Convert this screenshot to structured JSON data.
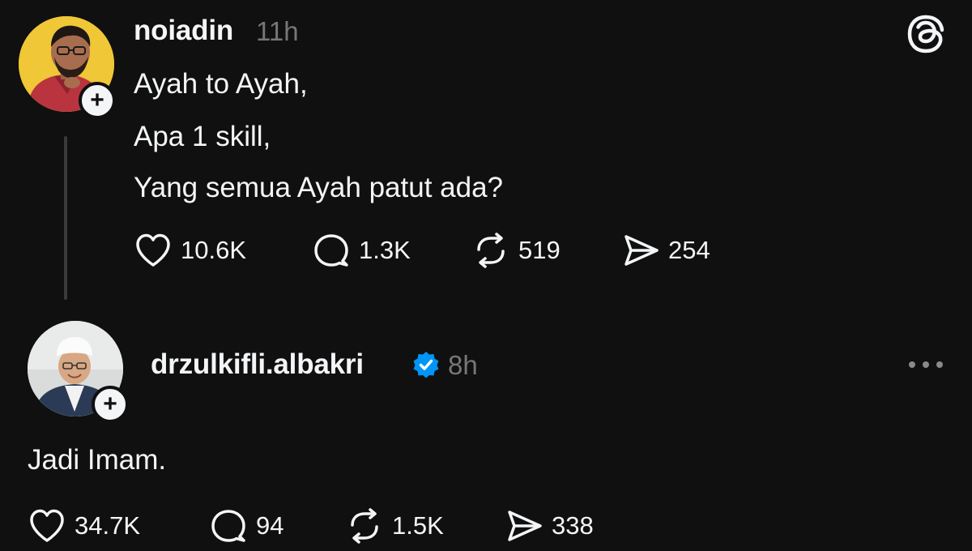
{
  "app": {
    "logo_icon": "threads-logo-icon"
  },
  "posts": [
    {
      "username": "noiadin",
      "timestamp": "11h",
      "lines": [
        "Ayah to Ayah,",
        "Apa 1 skill,",
        "Yang semua Ayah patut ada?"
      ],
      "likes": "10.6K",
      "replies": "1.3K",
      "reposts": "519",
      "shares": "254",
      "follow_label": "+",
      "avatar_bg": "#efc737"
    },
    {
      "username": "drzulkifli.albakri",
      "verified": true,
      "timestamp": "8h",
      "text": "Jadi Imam.",
      "likes": "34.7K",
      "replies": "94",
      "reposts": "1.5K",
      "shares": "338",
      "follow_label": "+",
      "avatar_bg": "#e9ebea"
    }
  ],
  "colors": {
    "background": "#101010",
    "text_primary": "#f3f5f7",
    "text_secondary": "#777777",
    "verified_blue": "#0095f6",
    "thread_line": "#3a3a3a"
  }
}
